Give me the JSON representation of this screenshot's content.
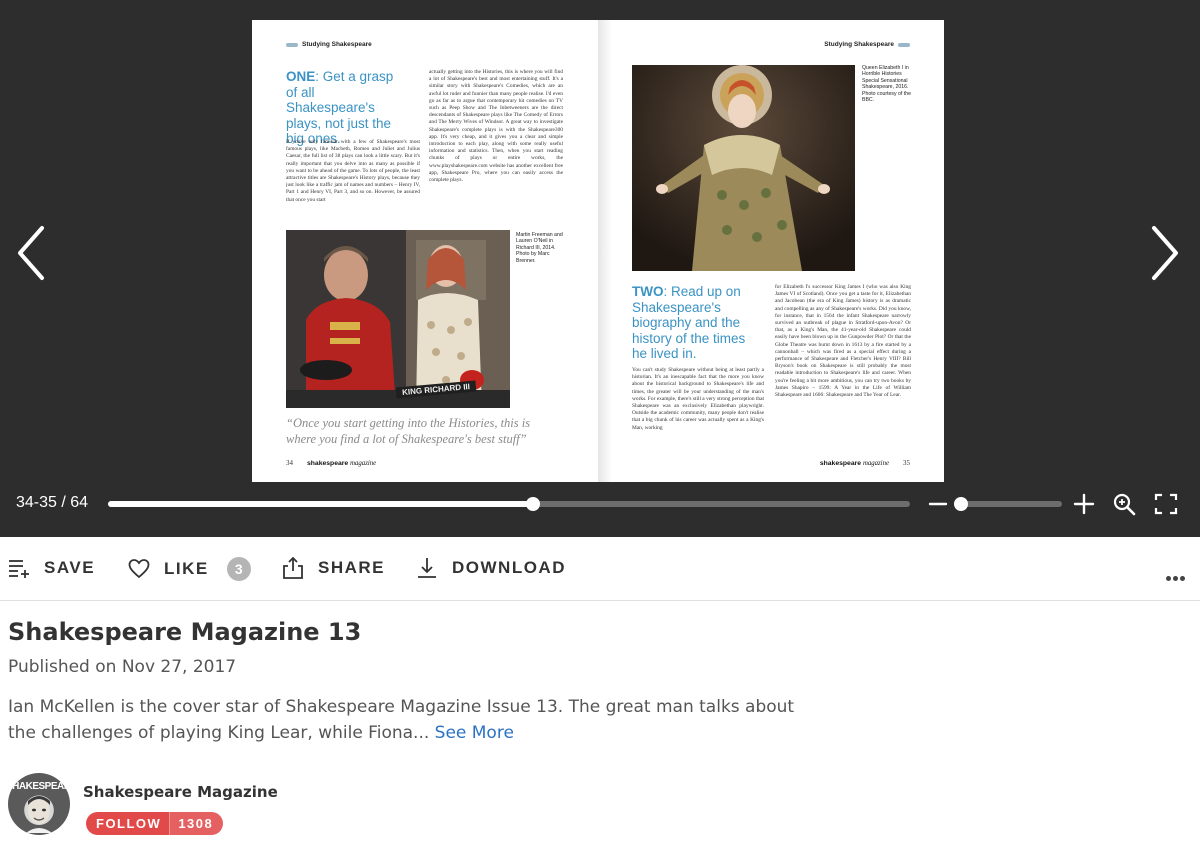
{
  "colors": {
    "viewer_bg": "#2d2d2d",
    "accent_blue": "#3a93c4",
    "follow_red": "#e24a4a",
    "link": "#2a72c4"
  },
  "viewer": {
    "prev_icon": "chevron-left-icon",
    "next_icon": "chevron-right-icon",
    "left_page": {
      "running_head": "Studying Shakespeare",
      "headline_lead": "ONE",
      "headline_rest": ": Get a grasp of all Shakespeare's plays, not just the big ones.",
      "col1_text": "If you're only familiar with a few of Shakespeare's most famous plays, like Macbeth, Romeo and Juliet and Julius Caesar, the full list of 38 plays can look a little scary. But it's really important that you delve into as many as possible if you want to be ahead of the game. To lots of people, the least attractive titles are Shakespeare's History plays, because they just look like a traffic jam of names and numbers – Henry IV, Part 1 and Henry VI, Part 3, and so on. However, be assured that once you start",
      "col2_text": "actually getting into the Histories, this is where you will find a lot of Shakespeare's best and most entertaining stuff. It's a similar story with Shakespeare's Comedies, which are an awful lot ruder and funnier than many people realise. I'd even go as far as to argue that contemporary hit comedies on TV such as Peep Show and The Inbetweeners are the direct descendants of Shakespeare plays like The Comedy of Errors and The Merry Wives of Windsor. A great way to investigate Shakespeare's complete plays is with the Shakespeare300 app. It's very cheap, and it gives you a clear and simple introduction to each play, along with some really useful information and statistics. Then, when you start reading chunks of plays or entire works, the www.playshakespeare.com website has another excellent free app, Shakespeare Pro, where you can easily access the complete plays.",
      "photo_caption": "Martin Freeman and Lauren O'Neil in Richard III, 2014. Photo by Marc Brenner.",
      "photo_sign": "KING RICHARD III",
      "pull_quote": "“Once you start getting into the Histories, this is where you find a lot of Shakespeare's best stuff”",
      "page_number": "34",
      "brand": "shakespeare",
      "brand_suffix": "magazine"
    },
    "right_page": {
      "running_head": "Studying Shakespeare",
      "photo_caption": "Queen Elizabeth I in Horrible Histories Special Sensational Shakespeare, 2016. Photo courtesy of the BBC.",
      "headline_lead": "TWO",
      "headline_rest": ": Read up on Shakespeare's biography and the history of the times he lived in.",
      "col1_text": "You can't study Shakespeare without being at least partly a historian. It's an inescapable fact that the more you know about the historical background to Shakespeare's life and times, the greater will be your understanding of the man's works. For example, there's still a very strong perception that Shakespeare was an exclusively Elizabethan playwright. Outside the academic community, many people don't realise that a big chunk of his career was actually spent as a King's Man, working",
      "col2_text": "for Elizabeth I's successor King James I (who was also King James VI of Scotland). Once you get a taste for it, Elizabethan and Jacobean (the era of King James) history is as dramatic and compelling as any of Shakespeare's works. Did you know, for instance, that in 1564 the infant Shakespeare narrowly survived an outbreak of plague in Stratford-upon-Avon? Or that, as a King's Man, the 41-year-old Shakespeare could easily have been blown up in the Gunpowder Plot? Or that the Globe Theatre was burnt down in 1613 by a fire started by a cannonball – which was fired as a special effect during a performance of Shakespeare and Fletcher's Henry VIII? Bill Bryson's book on Shakespeare is still probably the most readable introduction to Shakespeare's life and career. When you're feeling a bit more ambitious, you can try two books by James Shapiro – 1599: A Year in the Life of William Shakespeare and 1606: Shakespeare and The Year of Lear.",
      "page_number": "35",
      "brand": "shakespeare",
      "brand_suffix": "magazine"
    }
  },
  "controls": {
    "page_indicator": "34-35 / 64",
    "progress_fraction": 0.53,
    "zoom_fraction": 0.06,
    "zoom_out_icon": "minus-icon",
    "zoom_in_icon": "plus-icon",
    "magnifier_icon": "zoom-search-icon",
    "fullscreen_icon": "fullscreen-icon"
  },
  "actions": {
    "save_label": "SAVE",
    "like_label": "LIKE",
    "like_count": "3",
    "share_label": "SHARE",
    "download_label": "DOWNLOAD",
    "more_icon": "more-horizontal-icon"
  },
  "publication": {
    "title": "Shakespeare Magazine 13",
    "published": "Published on Nov 27, 2017",
    "description": "Ian McKellen is the cover star of Shakespeare Magazine Issue 13. The great man talks about the challenges of playing King Lear, while Fiona...",
    "see_more": "See More"
  },
  "publisher": {
    "avatar_text": "SHAKESPEARE",
    "name": "Shakespeare Magazine",
    "follow_label": "FOLLOW",
    "follower_count": "1308"
  }
}
